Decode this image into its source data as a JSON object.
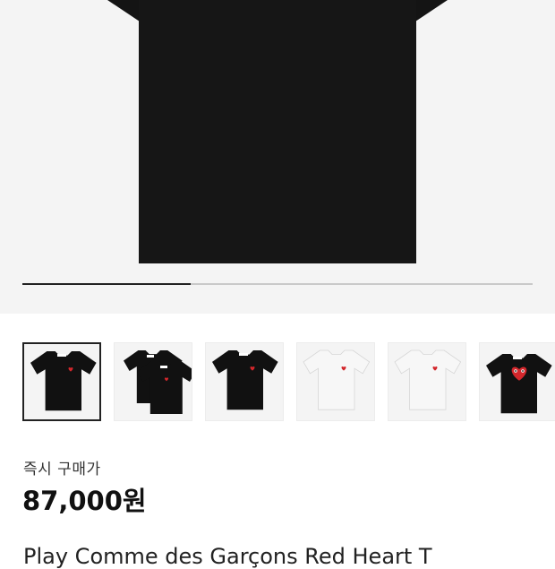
{
  "carousel": {
    "progress_fraction": 0.33
  },
  "thumbnails": [
    {
      "icon": "black-tshirt-small-heart-icon",
      "shirt_color": "#111111",
      "selected": true
    },
    {
      "icon": "two-black-tshirts-icon",
      "shirt_color": "#111111",
      "selected": false
    },
    {
      "icon": "black-tshirt-small-heart-icon",
      "shirt_color": "#111111",
      "selected": false
    },
    {
      "icon": "white-tshirt-small-heart-icon",
      "shirt_color": "#f7f7f7",
      "selected": false
    },
    {
      "icon": "white-tshirt-small-heart-icon",
      "shirt_color": "#f7f7f7",
      "selected": false
    },
    {
      "icon": "black-tshirt-big-heart-icon",
      "shirt_color": "#111111",
      "selected": false
    }
  ],
  "colors": {
    "heart_red": "#d3272c",
    "hero_background": "#f4f4f4"
  },
  "product": {
    "price_label": "즉시 구매가",
    "price": "87,000원",
    "title": "Play Comme des Garçons Red Heart T"
  }
}
